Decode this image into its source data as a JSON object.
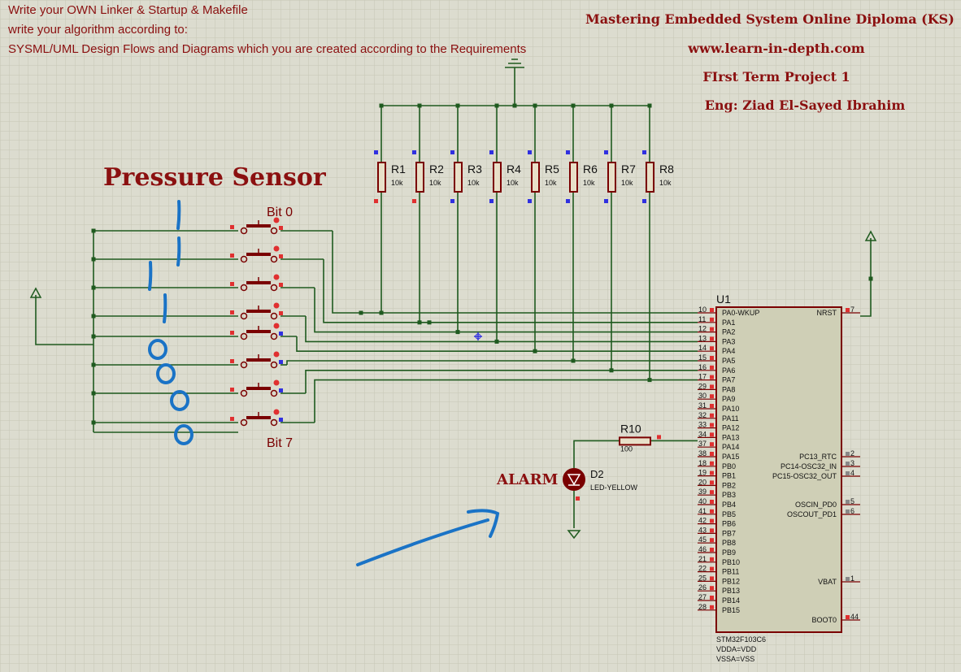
{
  "notes": {
    "line1": "Write your OWN Linker & Startup & Makefile",
    "line2": "write your algorithm according to:",
    "line3": "SYSML/UML  Design Flows and Diagrams which you are created according to the Requirements"
  },
  "title_block": {
    "diploma": "Mastering Embedded System Online Diploma (KS)",
    "website": "www.learn-in-depth.com",
    "project": "FIrst Term Project 1",
    "engineer": "Eng:  Ziad El-Sayed Ibrahim"
  },
  "sensor_label": "Pressure Sensor",
  "alarm_label": "ALARM",
  "bit_labels": {
    "first": "Bit 0",
    "last": "Bit 7"
  },
  "handwriting": {
    "digits": [
      "1",
      "1",
      "1",
      "1",
      "0",
      "0",
      "0",
      "0"
    ]
  },
  "resistors": [
    {
      "name": "R1",
      "value": "10k"
    },
    {
      "name": "R2",
      "value": "10k"
    },
    {
      "name": "R3",
      "value": "10k"
    },
    {
      "name": "R4",
      "value": "10k"
    },
    {
      "name": "R5",
      "value": "10k"
    },
    {
      "name": "R6",
      "value": "10k"
    },
    {
      "name": "R7",
      "value": "10k"
    },
    {
      "name": "R8",
      "value": "10k"
    }
  ],
  "r10": {
    "name": "R10",
    "value": "100"
  },
  "led": {
    "name": "D2",
    "type": "LED-YELLOW"
  },
  "mcu": {
    "ref": "U1",
    "part": "STM32F103C6",
    "power1": "VDDA=VDD",
    "power2": "VSSA=VSS",
    "left_pins": [
      {
        "num": "10",
        "name": "PA0-WKUP"
      },
      {
        "num": "11",
        "name": "PA1"
      },
      {
        "num": "12",
        "name": "PA2"
      },
      {
        "num": "13",
        "name": "PA3"
      },
      {
        "num": "14",
        "name": "PA4"
      },
      {
        "num": "15",
        "name": "PA5"
      },
      {
        "num": "16",
        "name": "PA6"
      },
      {
        "num": "17",
        "name": "PA7"
      },
      {
        "num": "29",
        "name": "PA8"
      },
      {
        "num": "30",
        "name": "PA9"
      },
      {
        "num": "31",
        "name": "PA10"
      },
      {
        "num": "32",
        "name": "PA11"
      },
      {
        "num": "33",
        "name": "PA12"
      },
      {
        "num": "34",
        "name": "PA13"
      },
      {
        "num": "37",
        "name": "PA14"
      },
      {
        "num": "38",
        "name": "PA15"
      },
      {
        "num": "18",
        "name": "PB0"
      },
      {
        "num": "19",
        "name": "PB1"
      },
      {
        "num": "20",
        "name": "PB2"
      },
      {
        "num": "39",
        "name": "PB3"
      },
      {
        "num": "40",
        "name": "PB4"
      },
      {
        "num": "41",
        "name": "PB5"
      },
      {
        "num": "42",
        "name": "PB6"
      },
      {
        "num": "43",
        "name": "PB7"
      },
      {
        "num": "45",
        "name": "PB8"
      },
      {
        "num": "46",
        "name": "PB9"
      },
      {
        "num": "21",
        "name": "PB10"
      },
      {
        "num": "22",
        "name": "PB11"
      },
      {
        "num": "25",
        "name": "PB12"
      },
      {
        "num": "26",
        "name": "PB13"
      },
      {
        "num": "27",
        "name": "PB14"
      },
      {
        "num": "28",
        "name": "PB15"
      }
    ],
    "right_pins": [
      {
        "num": "7",
        "name": "NRST"
      },
      {
        "num": "2",
        "name": "PC13_RTC"
      },
      {
        "num": "3",
        "name": "PC14-OSC32_IN"
      },
      {
        "num": "4",
        "name": "PC15-OSC32_OUT"
      },
      {
        "num": "5",
        "name": "OSCIN_PD0"
      },
      {
        "num": "6",
        "name": "OSCOUT_PD1"
      },
      {
        "num": "1",
        "name": "VBAT"
      },
      {
        "num": "44",
        "name": "BOOT0"
      }
    ]
  },
  "colors": {
    "background": "#dcdccf",
    "grid": "#c6c6b6",
    "wire": "#1f5a1f",
    "component": "#7a0000",
    "chip_fill": "#cfcfb6",
    "label_red": "#8b1010",
    "pin_red": "#e03030",
    "pin_blue": "#3030e0",
    "ink_blue": "#1a73c6"
  }
}
